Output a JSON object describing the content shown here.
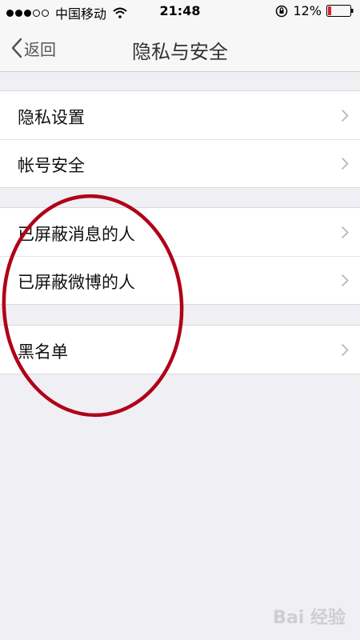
{
  "status_bar": {
    "carrier": "中国移动",
    "time": "21:48",
    "battery": "12%"
  },
  "nav": {
    "back_label": "返回",
    "title": "隐私与安全"
  },
  "groups": [
    {
      "items": [
        {
          "label": "隐私设置"
        },
        {
          "label": "帐号安全"
        }
      ]
    },
    {
      "items": [
        {
          "label": "已屏蔽消息的人"
        },
        {
          "label": "已屏蔽微博的人"
        }
      ]
    },
    {
      "items": [
        {
          "label": "黑名单"
        }
      ]
    }
  ],
  "watermark": "Bai 经验",
  "colors": {
    "annotation": "#b00018",
    "background": "#efeff4",
    "battery_low": "#e0202a"
  }
}
